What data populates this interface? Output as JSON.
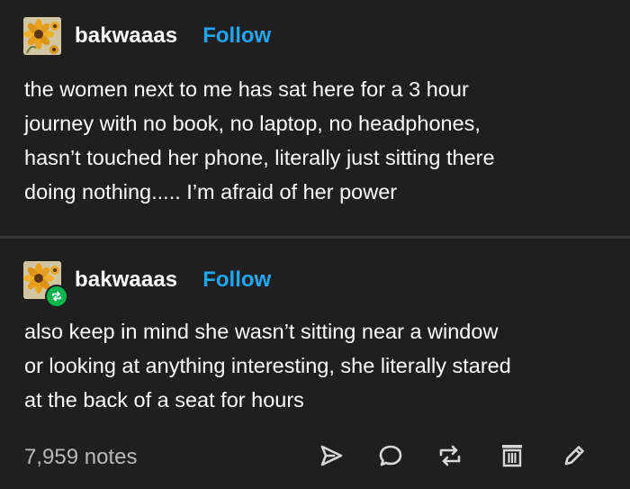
{
  "posts": [
    {
      "username": "bakwaaas",
      "follow_label": "Follow",
      "lines": [
        "the women next to me has sat here for a 3 hour",
        "journey with no book, no laptop, no headphones,",
        "hasn’t touched her phone, literally just sitting there",
        "doing nothing..... I’m afraid of her power"
      ]
    },
    {
      "username": "bakwaaas",
      "follow_label": "Follow",
      "lines": [
        "also keep in mind she wasn’t sitting near a window",
        "or looking at anything interesting, she literally stared",
        "at the back of a seat for hours"
      ]
    }
  ],
  "footer": {
    "notes": "7,959 notes",
    "icons": [
      "share-icon",
      "reply-icon",
      "reblog-icon",
      "delete-icon",
      "edit-icon"
    ]
  },
  "colors": {
    "background": "#1f1f1f",
    "text": "#ffffff",
    "follow": "#1ea7ff",
    "notes": "#b8b8b8",
    "reblog_badge": "#00b34a"
  }
}
